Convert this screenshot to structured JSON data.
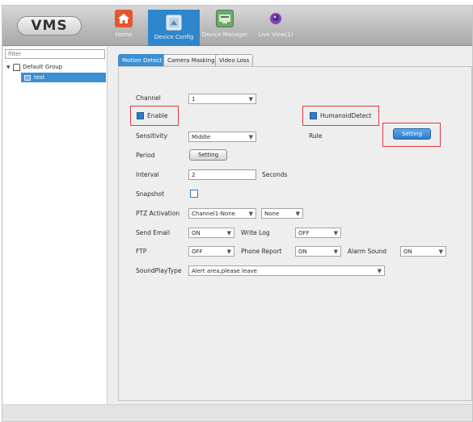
{
  "app": {
    "logo": "VMS"
  },
  "nav": {
    "items": [
      {
        "id": "home",
        "label": "Home",
        "icon": "home-icon"
      },
      {
        "id": "device-config",
        "label": "Device Config",
        "icon": "device-config-icon",
        "active": true
      },
      {
        "id": "device-manager",
        "label": "Device Manager",
        "icon": "device-manager-icon"
      },
      {
        "id": "live-view",
        "label": "Live View(1)",
        "icon": "live-view-icon"
      }
    ]
  },
  "sidebar": {
    "filter_placeholder": "filter",
    "group": "Default Group",
    "device": "test"
  },
  "tabs": [
    "Motion Detect",
    "Camera Masking",
    "Video Loss"
  ],
  "form": {
    "channel": {
      "label": "Channel",
      "value": "1"
    },
    "enable": {
      "label": "Enable",
      "checked": true
    },
    "humanoid": {
      "label": "HumanoidDetect",
      "checked": true
    },
    "sensitivity": {
      "label": "Sensitivity",
      "value": "Middle"
    },
    "rule": {
      "label": "Rule",
      "button": "Setting"
    },
    "period": {
      "label": "Period",
      "button": "Setting"
    },
    "interval": {
      "label": "Interval",
      "value": "2",
      "unit": "Seconds"
    },
    "snapshot": {
      "label": "Snapshot",
      "checked": false
    },
    "ptz": {
      "label": "PTZ Activation",
      "value1": "Channel1-None",
      "value2": "None"
    },
    "send_email": {
      "label": "Send Email",
      "value": "ON"
    },
    "write_log": {
      "label": "Write Log",
      "value": "OFF"
    },
    "ftp": {
      "label": "FTP",
      "value": "OFF"
    },
    "phone_report": {
      "label": "Phone Report",
      "value": "ON"
    },
    "alarm_sound": {
      "label": "Alarm Sound",
      "value": "ON"
    },
    "sound_play_type": {
      "label": "SoundPlayType",
      "value": "Alert area,please leave"
    }
  },
  "colors": {
    "accent": "#2e86cc",
    "highlight": "#e23a3a"
  }
}
